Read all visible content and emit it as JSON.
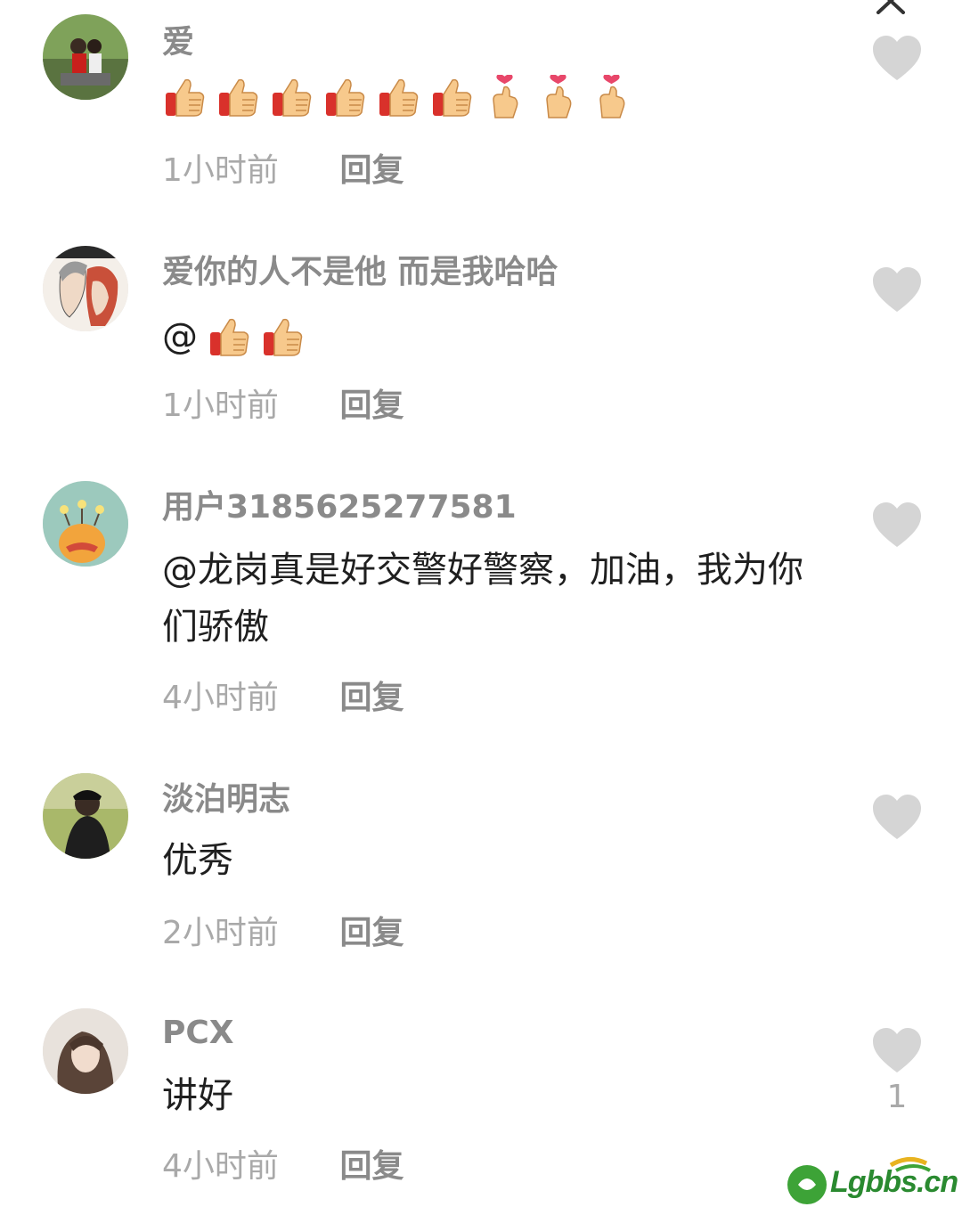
{
  "comments": [
    {
      "username": "爱",
      "content_emoji": [
        "thumbs-up",
        "thumbs-up",
        "thumbs-up",
        "thumbs-up",
        "thumbs-up",
        "thumbs-up",
        "finger-heart",
        "finger-heart",
        "finger-heart"
      ],
      "time": "1小时前",
      "reply_label": "回复"
    },
    {
      "username": "爱你的人不是他 而是我哈哈",
      "content_prefix": "@",
      "content_emoji": [
        "thumbs-up",
        "thumbs-up"
      ],
      "time": "1小时前",
      "reply_label": "回复"
    },
    {
      "username": "用户3185625277581",
      "content": "@龙岗真是好交警好警察，加油，我为你们骄傲",
      "time": "4小时前",
      "reply_label": "回复"
    },
    {
      "username": "淡泊明志",
      "content": "优秀",
      "time": "2小时前",
      "reply_label": "回复"
    },
    {
      "username": "PCX",
      "content": "讲好",
      "time": "4小时前",
      "reply_label": "回复",
      "like_count": "1"
    }
  ],
  "watermark": {
    "text": "Lgbbs.cn"
  },
  "colors": {
    "username": "#8a8a8a",
    "timestamp": "#a9a9a9",
    "content": "#1f1f1f",
    "like_icon": "#d5d5d5",
    "watermark": "#2a8a30"
  },
  "icons": {
    "like": "heart-icon",
    "close": "close-icon"
  }
}
